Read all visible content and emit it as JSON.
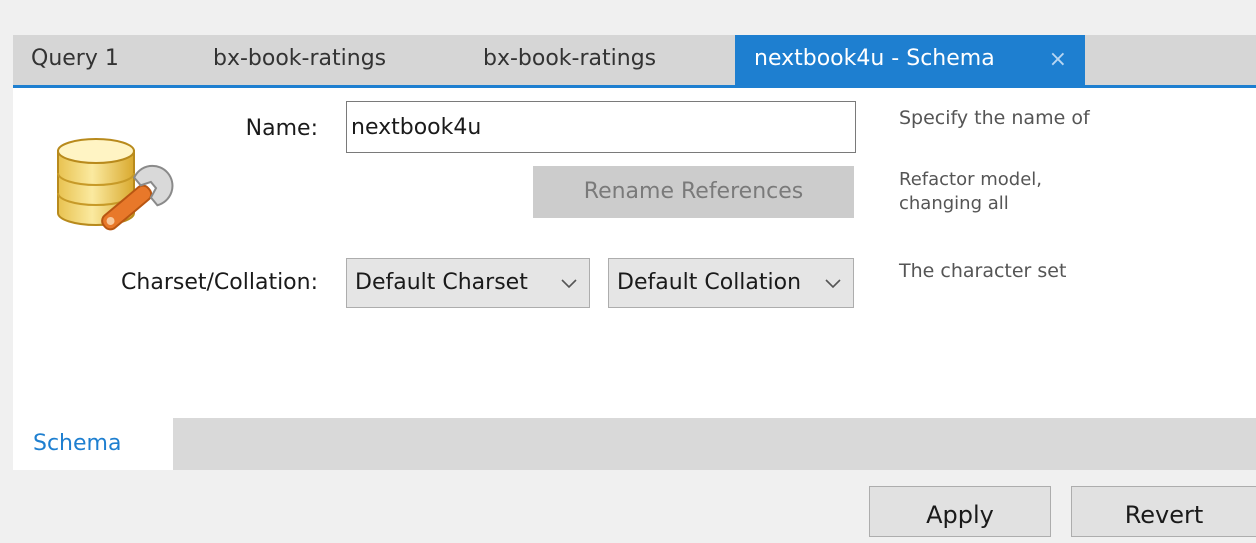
{
  "tabs": [
    {
      "label": "Query 1",
      "active": false
    },
    {
      "label": "bx-book-ratings",
      "active": false
    },
    {
      "label": "bx-book-ratings",
      "active": false
    },
    {
      "label": "nextbook4u - Schema",
      "active": true,
      "close": "×"
    }
  ],
  "form": {
    "name_label": "Name:",
    "name_value": "nextbook4u",
    "rename_button": "Rename References",
    "charset_label": "Charset/Collation:",
    "charset_value": "Default Charset",
    "collation_value": "Default Collation"
  },
  "descriptions": {
    "name": "Specify the name of",
    "rename": "Refactor model, changing all",
    "charset": "The character set"
  },
  "bottom_tabs": [
    {
      "label": "Schema",
      "active": true
    }
  ],
  "actions": {
    "apply": "Apply",
    "revert": "Revert"
  },
  "icons": {
    "schema": "database-wrench-icon",
    "dropdown": "chevron-down-icon",
    "close": "close-icon"
  },
  "colors": {
    "accent": "#1e7fd0",
    "background": "#f0f0f0",
    "panel": "#ffffff",
    "disabled_button": "#cccccc"
  }
}
